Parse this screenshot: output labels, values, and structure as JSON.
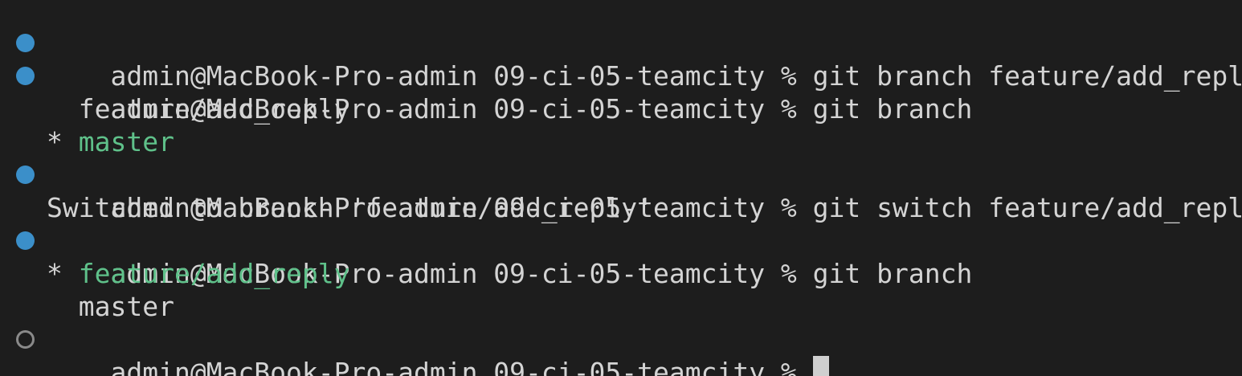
{
  "terminal": {
    "prompt": "admin@MacBook-Pro-admin 09-ci-05-teamcity %",
    "lines": [
      {
        "type": "command",
        "status": "success",
        "command": "git branch feature/add_reply"
      },
      {
        "type": "command",
        "status": "success",
        "command": "git branch"
      },
      {
        "type": "output",
        "text": "  feature/add_reply"
      },
      {
        "type": "output",
        "star": "* ",
        "current_branch": "master"
      },
      {
        "type": "command",
        "status": "success",
        "command": "git switch feature/add_reply"
      },
      {
        "type": "output",
        "text": "Switched to branch 'feature/add_reply'"
      },
      {
        "type": "command",
        "status": "success",
        "command": "git branch"
      },
      {
        "type": "output",
        "star": "* ",
        "current_branch": "feature/add_reply"
      },
      {
        "type": "output",
        "text": "  master"
      },
      {
        "type": "command",
        "status": "pending",
        "command": ""
      }
    ],
    "colors": {
      "background": "#1d1d1d",
      "text": "#d4d4d4",
      "success_marker": "#3b8fc9",
      "pending_marker": "#8a8a8a",
      "current_branch": "#5fc18a",
      "cursor": "#cfcfcf"
    }
  }
}
